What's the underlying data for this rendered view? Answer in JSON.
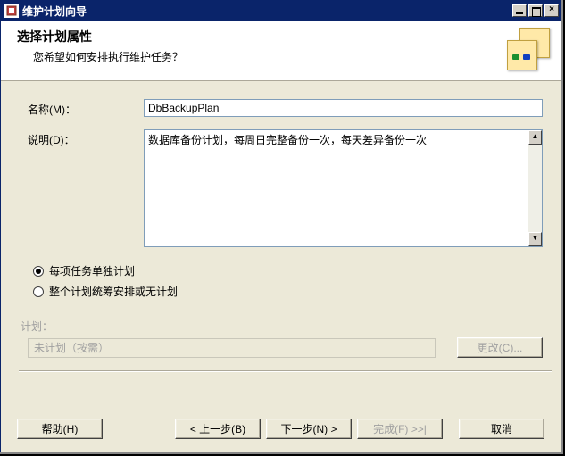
{
  "window": {
    "title": "维护计划向导"
  },
  "header": {
    "title": "选择计划属性",
    "subtitle": "您希望如何安排执行维护任务？"
  },
  "form": {
    "name_label": "名称(M)：",
    "name_value": "DbBackupPlan",
    "desc_label": "说明(D)：",
    "desc_value": "数据库备份计划，每周日完整备份一次，每天差异备份一次"
  },
  "radios": {
    "option1": "每项任务单独计划",
    "option2": "整个计划统筹安排或无计划",
    "selected": 0
  },
  "plan": {
    "section_label": "计划：",
    "value": "未计划（按需）",
    "change_label": "更改(C)..."
  },
  "footer": {
    "help": "帮助(H)",
    "back": "< 上一步(B)",
    "next": "下一步(N) >",
    "finish": "完成(F) >>|",
    "cancel": "取消"
  }
}
